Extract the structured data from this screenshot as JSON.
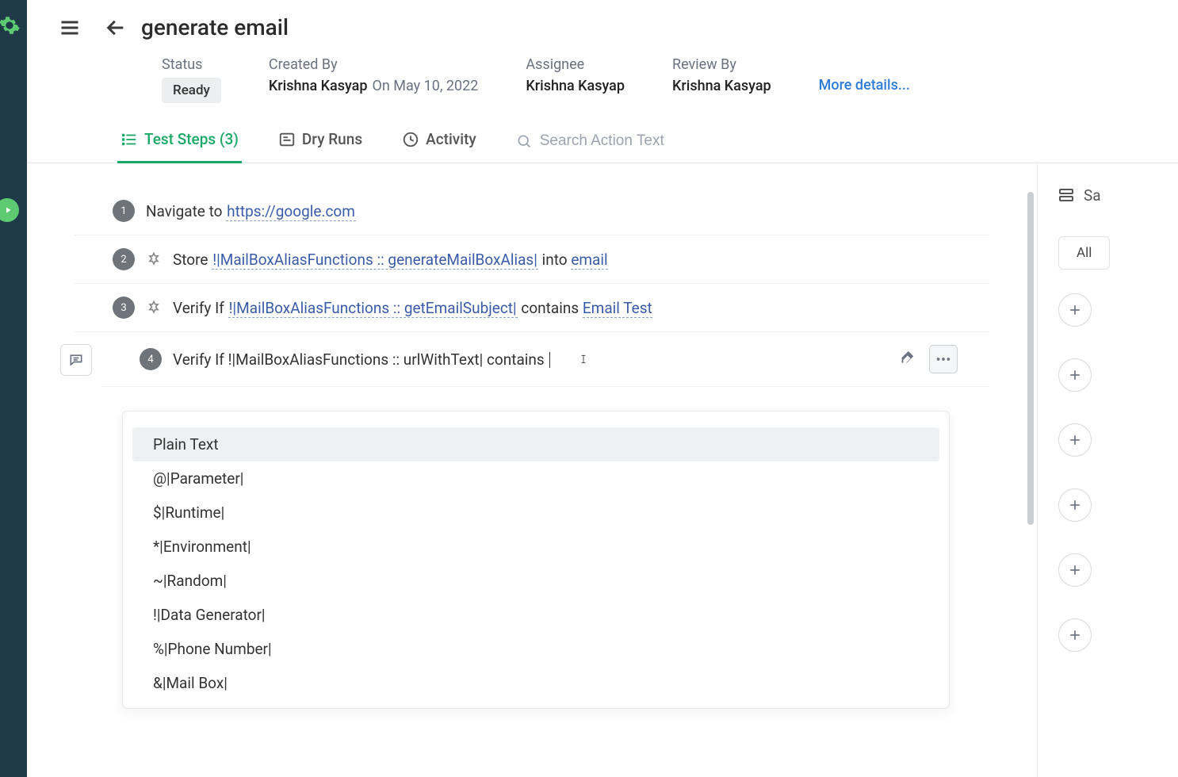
{
  "page": {
    "title": "generate email"
  },
  "meta": {
    "status_label": "Status",
    "status_value": "Ready",
    "created_label": "Created By",
    "created_value": "Krishna Kasyap",
    "created_date": "On May 10, 2022",
    "assignee_label": "Assignee",
    "assignee_value": "Krishna Kasyap",
    "review_label": "Review By",
    "review_value": "Krishna Kasyap",
    "more": "More details..."
  },
  "tabs": {
    "steps": "Test Steps (3)",
    "dryruns": "Dry Runs",
    "activity": "Activity",
    "search_placeholder": "Search Action Text"
  },
  "steps": {
    "s1_num": "1",
    "s1_prefix": "Navigate to ",
    "s1_url": "https://google.com",
    "s2_num": "2",
    "s2_prefix": "Store ",
    "s2_func": "!|MailBoxAliasFunctions :: generateMailBoxAlias|",
    "s2_mid": " into ",
    "s2_var": "email",
    "s3_num": "3",
    "s3_prefix": "Verify If ",
    "s3_func": "!|MailBoxAliasFunctions :: getEmailSubject|",
    "s3_mid": " contains ",
    "s3_val": "Email Test",
    "s4_num": "4",
    "s4_text": "Verify If !|MailBoxAliasFunctions :: urlWithText| contains "
  },
  "dropdown": {
    "i0": "Plain Text",
    "i1": "@|Parameter|",
    "i2": "$|Runtime|",
    "i3": "*|Environment|",
    "i4": "~|Random|",
    "i5": "!|Data Generator|",
    "i6": "%|Phone Number|",
    "i7": "&|Mail Box|"
  },
  "right": {
    "save": "Sa",
    "all": "All"
  }
}
